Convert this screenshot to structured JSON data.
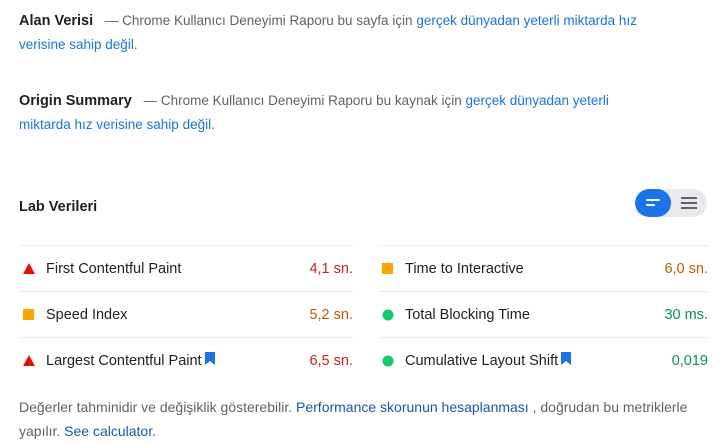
{
  "field": {
    "title": "Alan Verisi",
    "desc": "— Chrome Kullanıcı Deneyimi Raporu bu sayfa için",
    "link": "gerçek dünyadan yeterli miktarda hız verisine sahip değil",
    "suffix": "."
  },
  "origin": {
    "title": "Origin Summary",
    "desc": "— Chrome Kullanıcı Deneyimi Raporu bu kaynak için",
    "link": "gerçek dünyadan yeterli miktarda hız verisine sahip değil",
    "suffix": "."
  },
  "lab": {
    "title": "Lab Verileri"
  },
  "toggle": {
    "active_icon": "list-icon",
    "inactive_icon": "paragraph-icon"
  },
  "metrics": {
    "fcp": {
      "label": "First Contentful Paint",
      "value": "4,1 sn.",
      "status": "fail",
      "icon": "triangle-icon"
    },
    "si": {
      "label": "Speed Index",
      "value": "5,2 sn.",
      "status": "average",
      "icon": "square-icon"
    },
    "lcp": {
      "label": "Largest Contentful Paint",
      "value": "6,5 sn.",
      "status": "fail",
      "icon": "triangle-icon"
    },
    "tti": {
      "label": "Time to Interactive",
      "value": "6,0 sn.",
      "status": "average",
      "icon": "square-icon"
    },
    "tbt": {
      "label": "Total Blocking Time",
      "value": "30 ms.",
      "status": "pass",
      "icon": "circle-icon"
    },
    "cls": {
      "label": "Cumulative Layout Shift",
      "value": "0,019",
      "status": "pass",
      "icon": "circle-icon"
    }
  },
  "colors": {
    "fail": "#eb0f00",
    "average": "#ffa400",
    "pass": "#0cce6b",
    "link": "#1a73e8",
    "toggle_active": "#1a73e8"
  },
  "footer": {
    "text1": "Değerler tahminidir ve değişiklik gösterebilir.",
    "link1": "Performance skorunun hesaplanması",
    "text2": ", doğrudan bu metriklerle yapılır.",
    "link2": "See calculator."
  }
}
